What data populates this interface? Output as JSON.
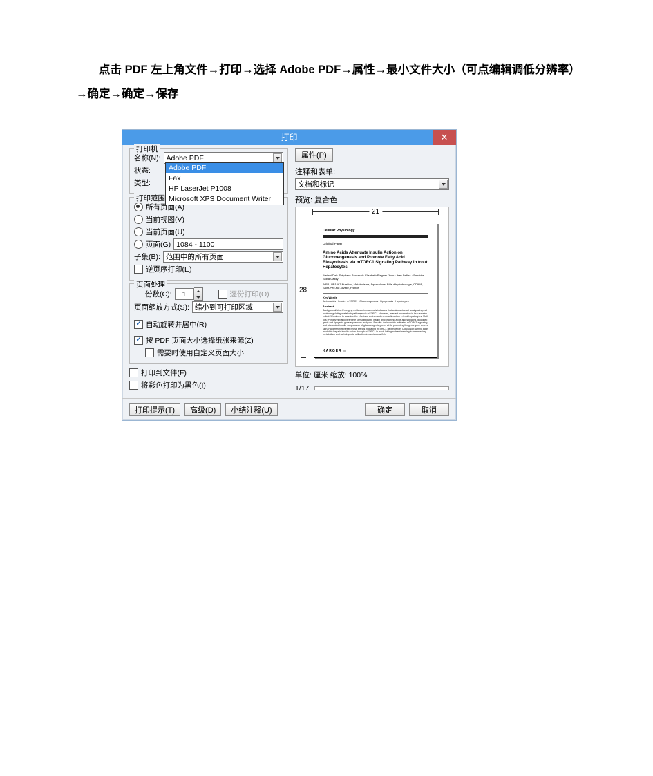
{
  "instruction": "点击 PDF 左上角文件→打印→选择 Adobe  PDF→属性→最小文件大小（可点编辑调低分辨率）→确定→确定→保存",
  "dialog": {
    "title": "打印",
    "close": "✕",
    "printer": {
      "legend": "打印机",
      "name_label": "名称(N):",
      "name_value": "Adobe PDF",
      "options": [
        "Adobe PDF",
        "Fax",
        "HP LaserJet P1008",
        "Microsoft XPS Document Writer"
      ],
      "status_label": "状态:",
      "type_label": "类型:",
      "properties_btn": "属性(P)",
      "comments_forms_label": "注释和表单:",
      "comments_forms_value": "文档和标记"
    },
    "range": {
      "legend": "打印范围",
      "all": "所有页面(A)",
      "current_view": "当前视图(V)",
      "current_page": "当前页面(U)",
      "pages_label": "页面(G)",
      "pages_value": "1084 - 1100",
      "subset_label": "子集(B):",
      "subset_value": "范围中的所有页面",
      "reverse": "逆页序打印(E)"
    },
    "handling": {
      "legend": "页面处理",
      "copies_label": "份数(C):",
      "copies_value": "1",
      "collate": "逐份打印(O)",
      "scaling_label": "页面缩放方式(S):",
      "scaling_value": "缩小到可打印区域",
      "auto_rotate": "自动旋转并居中(R)",
      "by_pdf_size": "按 PDF 页面大小选择纸张来源(Z)",
      "custom_size": "需要时使用自定义页面大小"
    },
    "print_to_file": "打印到文件(F)",
    "color_as_black": "将彩色打印为黑色(I)",
    "preview": {
      "label": "预览: 复合色",
      "w": "21",
      "h": "28",
      "units_line": "单位: 厘米 缩放: 100%",
      "page_counter": "1/17",
      "doc": {
        "journal": "Cellular Physiology",
        "section": "Original Paper",
        "title": "Amino Acids Attenuate Insulin Action on Gluconeogenesis and Promote Fatty Acid Biosynthesis via mTORC1 Signaling Pathway in trout Hepatocytes",
        "kw_label": "Key Words",
        "abs_label": "Abstract",
        "footer_brand": "KARGER"
      }
    },
    "footer": {
      "tips": "打印提示(T)",
      "advanced": "高级(D)",
      "summarize": "小结注释(U)",
      "ok": "确定",
      "cancel": "取消"
    }
  }
}
